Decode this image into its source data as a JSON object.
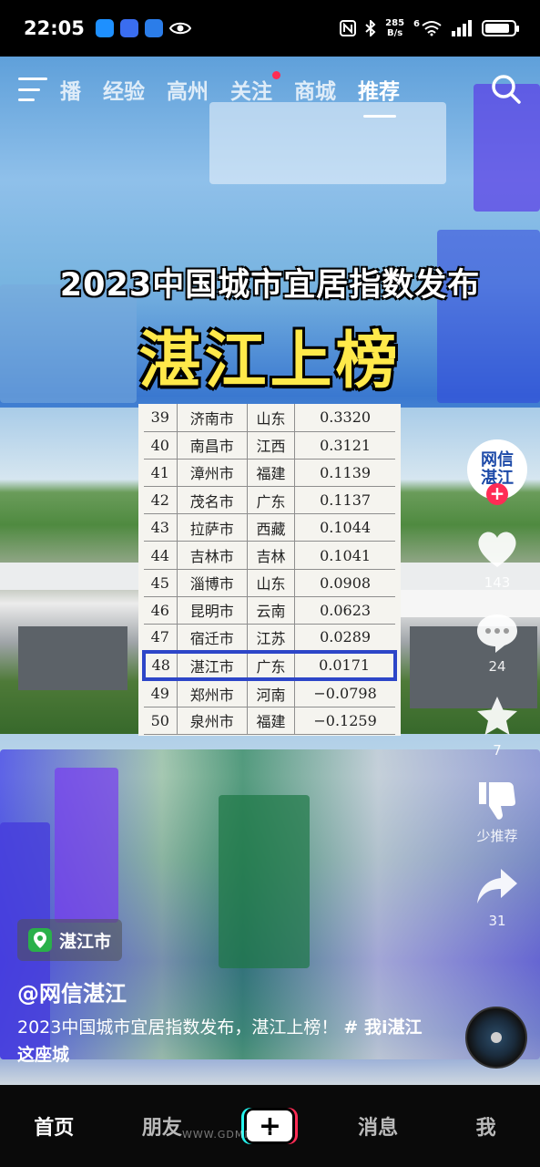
{
  "status_bar": {
    "time": "22:05",
    "net_speed_value": "285",
    "net_speed_unit": "B/s",
    "signal_label": "6",
    "battery_level_percent": 85
  },
  "top_nav": {
    "tabs": [
      {
        "label": "播",
        "active": false,
        "dot": false
      },
      {
        "label": "经验",
        "active": false,
        "dot": false
      },
      {
        "label": "高州",
        "active": false,
        "dot": false
      },
      {
        "label": "关注",
        "active": false,
        "dot": true
      },
      {
        "label": "商城",
        "active": false,
        "dot": false
      },
      {
        "label": "推荐",
        "active": true,
        "dot": false
      }
    ],
    "search_icon": "search-icon",
    "menu_icon": "menu-icon"
  },
  "video": {
    "title_line1": "2023中国城市宜居指数发布",
    "title_line2": "湛江上榜",
    "table_rows": [
      {
        "rank": "39",
        "city": "济南市",
        "province": "山东",
        "score": "0.3320",
        "highlight": false
      },
      {
        "rank": "40",
        "city": "南昌市",
        "province": "江西",
        "score": "0.3121",
        "highlight": false
      },
      {
        "rank": "41",
        "city": "漳州市",
        "province": "福建",
        "score": "0.1139",
        "highlight": false
      },
      {
        "rank": "42",
        "city": "茂名市",
        "province": "广东",
        "score": "0.1137",
        "highlight": false
      },
      {
        "rank": "43",
        "city": "拉萨市",
        "province": "西藏",
        "score": "0.1044",
        "highlight": false
      },
      {
        "rank": "44",
        "city": "吉林市",
        "province": "吉林",
        "score": "0.1041",
        "highlight": false
      },
      {
        "rank": "45",
        "city": "淄博市",
        "province": "山东",
        "score": "0.0908",
        "highlight": false
      },
      {
        "rank": "46",
        "city": "昆明市",
        "province": "云南",
        "score": "0.0623",
        "highlight": false
      },
      {
        "rank": "47",
        "city": "宿迁市",
        "province": "江苏",
        "score": "0.0289",
        "highlight": false
      },
      {
        "rank": "48",
        "city": "湛江市",
        "province": "广东",
        "score": "0.0171",
        "highlight": true
      },
      {
        "rank": "49",
        "city": "郑州市",
        "province": "河南",
        "score": "−0.0798",
        "highlight": false
      },
      {
        "rank": "50",
        "city": "泉州市",
        "province": "福建",
        "score": "−0.1259",
        "highlight": false
      }
    ]
  },
  "side_actions": {
    "avatar_text": "网信湛江",
    "like_count": "143",
    "comment_count": "24",
    "favorite_count": "7",
    "dislike_label": "少推荐",
    "share_count": "31"
  },
  "info": {
    "location": "湛江市",
    "author": "@网信湛江",
    "caption": "2023中国城市宜居指数发布，湛江上榜！",
    "caption_tag": "# 我i湛江这座城"
  },
  "bottom_nav": {
    "items": [
      {
        "label": "首页",
        "active": true
      },
      {
        "label": "朋友",
        "active": false
      },
      {
        "label": "+",
        "active": false
      },
      {
        "label": "消息",
        "active": false
      },
      {
        "label": "我",
        "active": false
      }
    ],
    "watermark": "WWW.GDMM.COM"
  },
  "colors": {
    "accent_red": "#ff2c55",
    "title_yellow": "#ffe94a",
    "highlight_blue": "#2d46c8",
    "location_green": "#2ab04a"
  }
}
